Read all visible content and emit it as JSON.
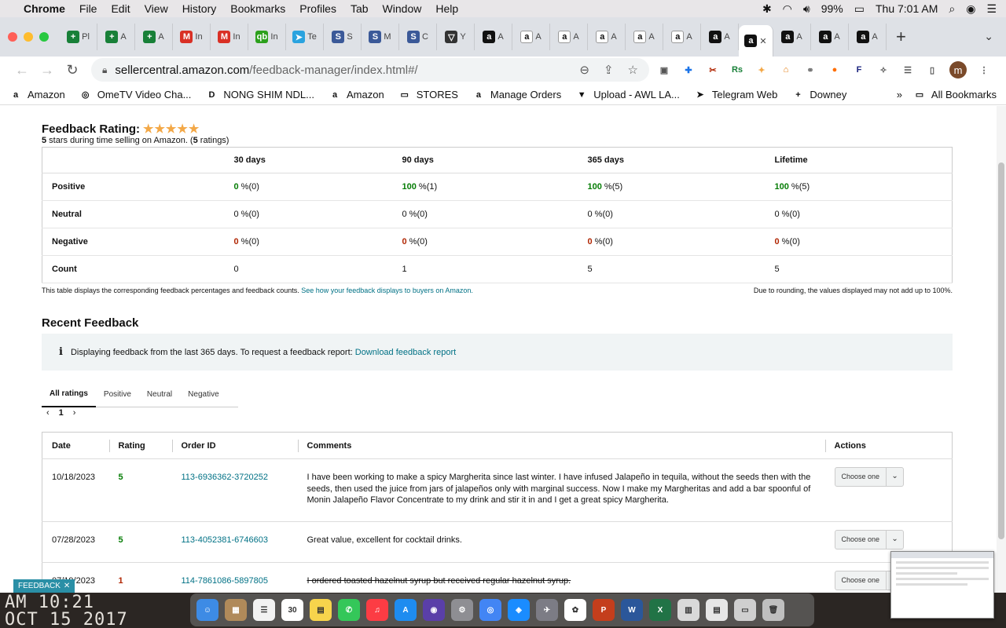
{
  "menubar": {
    "app": "Chrome",
    "items": [
      "File",
      "Edit",
      "View",
      "History",
      "Bookmarks",
      "Profiles",
      "Tab",
      "Window",
      "Help"
    ],
    "battery": "99%",
    "clock": "Thu 7:01 AM"
  },
  "tabs": [
    {
      "fav": "+",
      "color": "#188038",
      "label": "Pl"
    },
    {
      "fav": "+",
      "color": "#188038",
      "label": "A"
    },
    {
      "fav": "+",
      "color": "#188038",
      "label": "A"
    },
    {
      "fav": "M",
      "color": "#d93025",
      "label": "In"
    },
    {
      "fav": "M",
      "color": "#d93025",
      "label": "In"
    },
    {
      "fav": "qb",
      "color": "#2ca01c",
      "label": "In"
    },
    {
      "fav": "➤",
      "color": "#2aa3df",
      "label": "Te"
    },
    {
      "fav": "S",
      "color": "#3b5998",
      "label": "S"
    },
    {
      "fav": "S",
      "color": "#3b5998",
      "label": "M"
    },
    {
      "fav": "S",
      "color": "#3b5998",
      "label": "C"
    },
    {
      "fav": "▽",
      "color": "#333333",
      "label": "Y"
    },
    {
      "fav": "a",
      "color": "#111111",
      "label": "A"
    },
    {
      "fav": "a",
      "color": "#ffffff",
      "label": "A"
    },
    {
      "fav": "a",
      "color": "#ffffff",
      "label": "A"
    },
    {
      "fav": "a",
      "color": "#ffffff",
      "label": "A"
    },
    {
      "fav": "a",
      "color": "#ffffff",
      "label": "A"
    },
    {
      "fav": "a",
      "color": "#ffffff",
      "label": "A"
    },
    {
      "fav": "a",
      "color": "#111111",
      "label": "A"
    }
  ],
  "active_tab": {
    "fav": "a"
  },
  "tabs_after": [
    {
      "fav": "a",
      "color": "#111111",
      "label": "A"
    },
    {
      "fav": "a",
      "color": "#111111",
      "label": "A"
    },
    {
      "fav": "a",
      "color": "#111111",
      "label": "A"
    }
  ],
  "url": {
    "host": "sellercentral.amazon.com",
    "path": "/feedback-manager/index.html#/"
  },
  "profile_initial": "m",
  "bookmarks": [
    {
      "icon": "a",
      "label": "Amazon"
    },
    {
      "icon": "◎",
      "label": "OmeTV Video Cha..."
    },
    {
      "icon": "D",
      "label": "NONG SHIM NDL..."
    },
    {
      "icon": "a",
      "label": "Amazon"
    },
    {
      "icon": "▭",
      "label": "STORES"
    },
    {
      "icon": "a",
      "label": "Manage Orders"
    },
    {
      "icon": "▼",
      "label": "Upload - AWL LA..."
    },
    {
      "icon": "➤",
      "label": "Telegram Web"
    },
    {
      "icon": "+",
      "label": "Downey"
    }
  ],
  "bookmarks_more": "»",
  "all_bookmarks": "All Bookmarks",
  "rating": {
    "heading": "Feedback Rating:",
    "stars": "★★★★★",
    "sub_count": "5",
    "sub_text": " stars during time selling on Amazon. (",
    "sub_ratings": "5",
    "sub_end": " ratings)"
  },
  "summary": {
    "headers": [
      "30 days",
      "90 days",
      "365 days",
      "Lifetime"
    ],
    "rows": [
      {
        "label": "Positive",
        "kind": "pos",
        "cells": [
          [
            "0",
            " %(0)"
          ],
          [
            "100",
            " %(1)"
          ],
          [
            "100",
            " %(5)"
          ],
          [
            "100",
            " %(5)"
          ]
        ]
      },
      {
        "label": "Neutral",
        "kind": "neu",
        "cells": [
          [
            "0",
            " %(0)"
          ],
          [
            "0",
            " %(0)"
          ],
          [
            "0",
            " %(0)"
          ],
          [
            "0",
            " %(0)"
          ]
        ]
      },
      {
        "label": "Negative",
        "kind": "neg",
        "cells": [
          [
            "0",
            " %(0)"
          ],
          [
            "0",
            " %(0)"
          ],
          [
            "0",
            " %(0)"
          ],
          [
            "0",
            " %(0)"
          ]
        ]
      },
      {
        "label": "Count",
        "kind": "cnt",
        "cells": [
          [
            "0",
            ""
          ],
          [
            "1",
            ""
          ],
          [
            "5",
            ""
          ],
          [
            "5",
            ""
          ]
        ]
      }
    ],
    "note_left": "This table displays the corresponding feedback percentages and feedback counts.",
    "note_link": "See how your feedback displays to buyers on Amazon.",
    "note_right": "Due to rounding, the values displayed may not add up to 100%."
  },
  "recent": {
    "title": "Recent Feedback",
    "info_text": "Displaying feedback from the last 365 days. To request a feedback report:",
    "info_link": "Download feedback report",
    "tabs": [
      "All ratings",
      "Positive",
      "Neutral",
      "Negative"
    ],
    "page": "1",
    "columns": [
      "Date",
      "Rating",
      "Order ID",
      "Comments",
      "Actions"
    ],
    "rows": [
      {
        "date": "10/18/2023",
        "rating": "5",
        "rating_kind": "pos",
        "order": "113-6936362-3720252",
        "comment": "I have been working to make a spicy Margherita since last winter. I have infused Jalapeño in tequila, without the seeds then with the seeds, then used the juice from jars of jalapeños only with marginal success. Now I make my Margheritas and add a bar spoonful of Monin Jalapeño Flavor Concentrate to my drink and stir it in and I get a great spicy Margherita.",
        "strike": false,
        "action": "Choose one"
      },
      {
        "date": "07/28/2023",
        "rating": "5",
        "rating_kind": "pos",
        "order": "113-4052381-6746603",
        "comment": "Great value, excellent for cocktail drinks.",
        "strike": false,
        "action": "Choose one"
      },
      {
        "date": "07/19/2023",
        "rating": "1",
        "rating_kind": "neg",
        "order": "114-7861086-5897805",
        "comment": "I ordered toasted hazelnut syrup but received regular hazelnut syrup.",
        "strike": true,
        "action": "Choose one"
      }
    ]
  },
  "feedback_tag": "FEEDBACK",
  "desk_clock": [
    "AM 10:21",
    "OCT 15 2017"
  ],
  "dock": [
    {
      "label": "☺",
      "color": "#3d8be5"
    },
    {
      "label": "▦",
      "color": "#b08a5a"
    },
    {
      "label": "☰",
      "color": "#f2f2f2"
    },
    {
      "label": "30",
      "color": "#ffffff"
    },
    {
      "label": "▤",
      "color": "#f7d44c"
    },
    {
      "label": "✆",
      "color": "#34c759"
    },
    {
      "label": "♫",
      "color": "#fc3c44"
    },
    {
      "label": "A",
      "color": "#1e8cf0"
    },
    {
      "label": "◉",
      "color": "#5a3fa8"
    },
    {
      "label": "⚙",
      "color": "#8e8e93"
    },
    {
      "label": "◎",
      "color": "#4285f4"
    },
    {
      "label": "◈",
      "color": "#1a8cff"
    },
    {
      "label": "✈",
      "color": "#7c7c85"
    },
    {
      "label": "✿",
      "color": "#ffffff"
    },
    {
      "label": "P",
      "color": "#c43e1c"
    },
    {
      "label": "W",
      "color": "#2b579a"
    },
    {
      "label": "X",
      "color": "#217346"
    },
    {
      "label": "▥",
      "color": "#d9d9d9"
    },
    {
      "label": "▤",
      "color": "#e6e6e6"
    },
    {
      "label": "▭",
      "color": "#cfcfcf"
    },
    {
      "label": "🗑",
      "color": "#bfbfbf"
    }
  ],
  "colors": {
    "positive": "#067d06",
    "negative": "#b12704",
    "link": "#007185",
    "star": "#f3a847"
  }
}
